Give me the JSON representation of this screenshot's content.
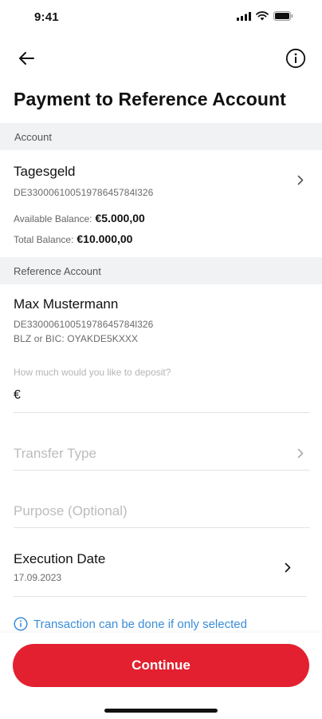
{
  "status_bar": {
    "time": "9:41"
  },
  "page": {
    "title": "Payment to Reference Account"
  },
  "account_section": {
    "header": "Account",
    "name": "Tagesgeld",
    "iban": "DE33000610051978645784l326",
    "available_label": "Available Balance:",
    "available_value": "€5.000,00",
    "total_label": "Total Balance:",
    "total_value": "€10.000,00"
  },
  "reference_section": {
    "header": "Reference Account",
    "name": "Max Mustermann",
    "iban": "DE33000610051978645784l326",
    "bic": "BLZ or BIC: OYAKDE5KXXX"
  },
  "deposit": {
    "label": "How much would you like to deposit?",
    "currency": "€"
  },
  "transfer_type": {
    "placeholder": "Transfer Type"
  },
  "purpose": {
    "placeholder": "Purpose (Optional)"
  },
  "execution": {
    "label": "Execution Date",
    "date": "17.09.2023"
  },
  "note": {
    "text": "Transaction can be done if only selected"
  },
  "cta": {
    "label": "Continue"
  },
  "colors": {
    "brand": "#e3202f",
    "info_blue": "#3a8dd8",
    "section_bg": "#f1f2f4"
  }
}
